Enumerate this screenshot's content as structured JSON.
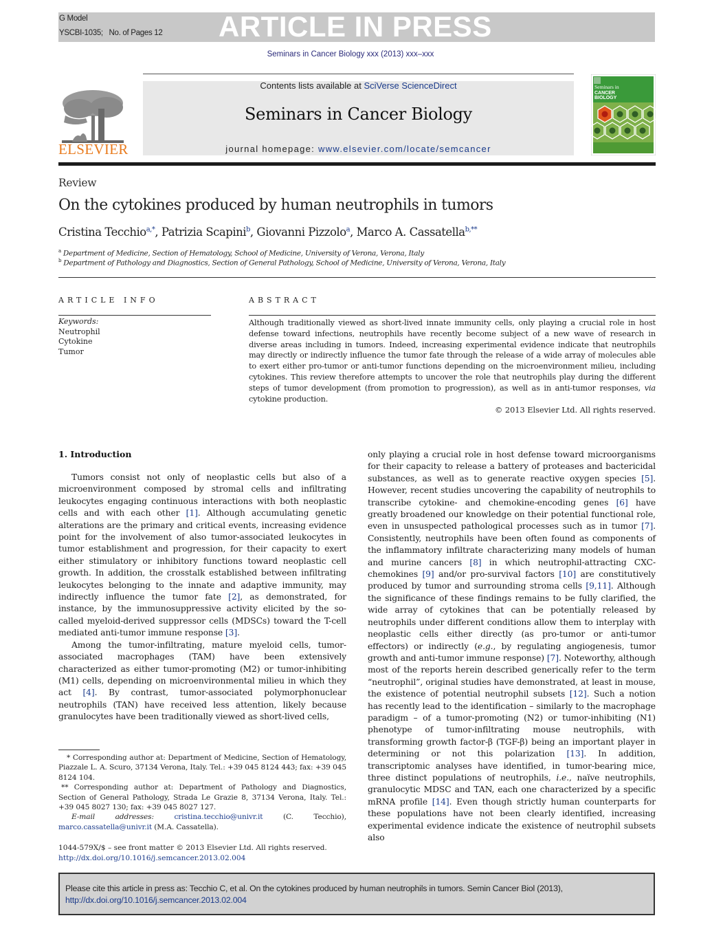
{
  "banner": {
    "model": "G Model",
    "doc_id": "YSCBI-1035;",
    "pages": "No. of Pages 12",
    "status": "ARTICLE IN PRESS",
    "journal_issue": "Seminars in Cancer Biology xxx (2013) xxx–xxx"
  },
  "header": {
    "contents_prefix": "Contents lists available at ",
    "contents_link": "SciVerse ScienceDirect",
    "journal_title": "Seminars in Cancer Biology",
    "homepage_prefix": "journal homepage: ",
    "homepage_link": "www.elsevier.com/locate/semcancer",
    "publisher_logo_text": "ELSEVIER",
    "cover": {
      "line1": "Seminars in",
      "line2": "CANCER",
      "line3": "BIOLOGY"
    },
    "colors": {
      "publisher_orange": "#e87a1c",
      "link_blue": "#1a3a8a",
      "cover_green": "#3a9a3a",
      "cover_orange": "#e0561c"
    }
  },
  "article": {
    "type": "Review",
    "title": "On the cytokines produced by human neutrophils in tumors",
    "authors": [
      {
        "name": "Cristina Tecchio",
        "marks": "a,*"
      },
      {
        "name": "Patrizia Scapini",
        "marks": "b"
      },
      {
        "name": "Giovanni Pizzolo",
        "marks": "a"
      },
      {
        "name": "Marco A. Cassatella",
        "marks": "b,**"
      }
    ],
    "affiliations": [
      {
        "mark": "a",
        "text": "Department of Medicine, Section of Hematology, School of Medicine, University of Verona, Verona, Italy"
      },
      {
        "mark": "b",
        "text": "Department of Pathology and Diagnostics, Section of General Pathology, School of Medicine, University of Verona, Verona, Italy"
      }
    ]
  },
  "article_info": {
    "heading": "ARTICLE INFO",
    "keywords_label": "Keywords:",
    "keywords": [
      "Neutrophil",
      "Cytokine",
      "Tumor"
    ]
  },
  "abstract": {
    "heading": "ABSTRACT",
    "text_main": "Although traditionally viewed as short-lived innate immunity cells, only playing a crucial role in host defense toward infections, neutrophils have recently become subject of a new wave of research in diverse areas including in tumors. Indeed, increasing experimental evidence indicate that neutrophils may directly or indirectly influence the tumor fate through the release of a wide array of molecules able to exert either pro-tumor or anti-tumor functions depending on the microenvironment milieu, including cytokines. This review therefore attempts to uncover the role that neutrophils play during the different steps of tumor development (from promotion to progression), as well as in anti-tumor responses, ",
    "text_italic": "via",
    "text_end": " cytokine production.",
    "copyright": "© 2013 Elsevier Ltd. All rights reserved."
  },
  "body": {
    "section_heading": "1.  Introduction",
    "left_p1": [
      {
        "t": "Tumors consist not only of neoplastic cells but also of a microenvironment composed by stromal cells and infiltrating leukocytes engaging continuous interactions with both neoplastic cells and with each other "
      },
      {
        "r": "[1]"
      },
      {
        "t": ". Although accumulating genetic alterations are the primary and critical events, increasing evidence point for the involvement of also tumor-associated leukocytes in tumor establishment and progression, for their capacity to exert either stimulatory or inhibitory functions toward neoplastic cell growth. In addition, the crosstalk established between infiltrating leukocytes belonging to the innate and adaptive immunity, may indirectly influence the tumor fate "
      },
      {
        "r": "[2]"
      },
      {
        "t": ", as demonstrated, for instance, by the immunosuppressive activity elicited by the so-called myeloid-derived suppressor cells (MDSCs) toward the T-cell mediated anti-tumor immune response "
      },
      {
        "r": "[3]"
      },
      {
        "t": "."
      }
    ],
    "left_p2": [
      {
        "t": "Among the tumor-infiltrating, mature myeloid cells, tumor-associated macrophages (TAM) have been extensively characterized as either tumor-promoting (M2) or tumor-inhibiting (M1) cells, depending on microenvironmental milieu in which they act "
      },
      {
        "r": "[4]"
      },
      {
        "t": ". By contrast, tumor-associated polymorphonuclear neutrophils (TAN) have received less attention, likely because granulocytes have been traditionally viewed as short-lived cells,"
      }
    ],
    "right_p1": [
      {
        "t": "only playing a crucial role in host defense toward microorganisms for their capacity to release a battery of proteases and bactericidal substances, as well as to generate reactive oxygen species "
      },
      {
        "r": "[5]"
      },
      {
        "t": ". However, recent studies uncovering the capability of neutrophils to transcribe cytokine- and chemokine-encoding genes "
      },
      {
        "r": "[6]"
      },
      {
        "t": " have greatly broadened our knowledge on their potential functional role, even in unsuspected pathological processes such as in tumor "
      },
      {
        "r": "[7]"
      },
      {
        "t": ". Consistently, neutrophils have been often found as components of the inflammatory infiltrate characterizing many models of human and murine cancers "
      },
      {
        "r": "[8]"
      },
      {
        "t": " in which neutrophil-attracting CXC-chemokines "
      },
      {
        "r": "[9]"
      },
      {
        "t": " and/or pro-survival factors "
      },
      {
        "r": "[10]"
      },
      {
        "t": " are constitutively produced by tumor and surrounding stroma cells "
      },
      {
        "r": "[9,11]"
      },
      {
        "t": ". Although the significance of these findings remains to be fully clarified, the wide array of cytokines that can be potentially released by neutrophils under different conditions allow them to interplay with neoplastic cells either directly (as pro-tumor or anti-tumor effectors) or indirectly ("
      },
      {
        "i": "e.g."
      },
      {
        "t": ", by regulating angiogenesis, tumor growth and anti-tumor immune response) "
      },
      {
        "r": "[7]"
      },
      {
        "t": ". Noteworthy, although most of the reports herein described generically refer to the term “neutrophil”, original studies have demonstrated, at least in mouse, the existence of potential neutrophil subsets "
      },
      {
        "r": "[12]"
      },
      {
        "t": ". Such a notion has recently lead to the identification – similarly to the macrophage paradigm – of a tumor-promoting (N2) or tumor-inhibiting (N1) phenotype of tumor-infiltrating mouse neutrophils, with transforming growth factor-β (TGF-β) being an important player in determining or not this polarization "
      },
      {
        "r": "[13]"
      },
      {
        "t": ". In addition, transcriptomic analyses have identified, in tumor-bearing mice, three distinct populations of neutrophils, "
      },
      {
        "i": "i.e."
      },
      {
        "t": ", naïve neutrophils, granulocytic MDSC and TAN, each one characterized by a specific mRNA profile "
      },
      {
        "r": "[14]"
      },
      {
        "t": ". Even though strictly human counterparts for these populations have not been clearly identified, increasing experimental evidence indicate the existence of neutrophil subsets also"
      }
    ]
  },
  "footnotes": {
    "fn1": "* Corresponding author at: Department of Medicine, Section of Hematology, Piazzale L. A. Scuro, 37134 Verona, Italy. Tel.: +39 045 8124 443; fax: +39 045 8124 104.",
    "fn2": "** Corresponding author at: Department of Pathology and Diagnostics, Section of General Pathology, Strada Le Grazie 8, 37134 Verona, Italy. Tel.: +39 045 8027 130; fax: +39 045 8027 127.",
    "email_label": "E-mail addresses: ",
    "email1": "cristina.tecchio@univr.it",
    "email1_name": " (C. Tecchio),",
    "email2": "marco.cassatella@univr.it",
    "email2_name": " (M.A. Cassatella).",
    "front_matter": "1044-579X/$ – see front matter © 2013 Elsevier Ltd. All rights reserved.",
    "doi": "http://dx.doi.org/10.1016/j.semcancer.2013.02.004"
  },
  "cite_box": {
    "text": "Please cite this article in press as: Tecchio C, et al. On the cytokines produced by human neutrophils in tumors. Semin Cancer Biol (2013),",
    "doi": "http://dx.doi.org/10.1016/j.semcancer.2013.02.004"
  }
}
